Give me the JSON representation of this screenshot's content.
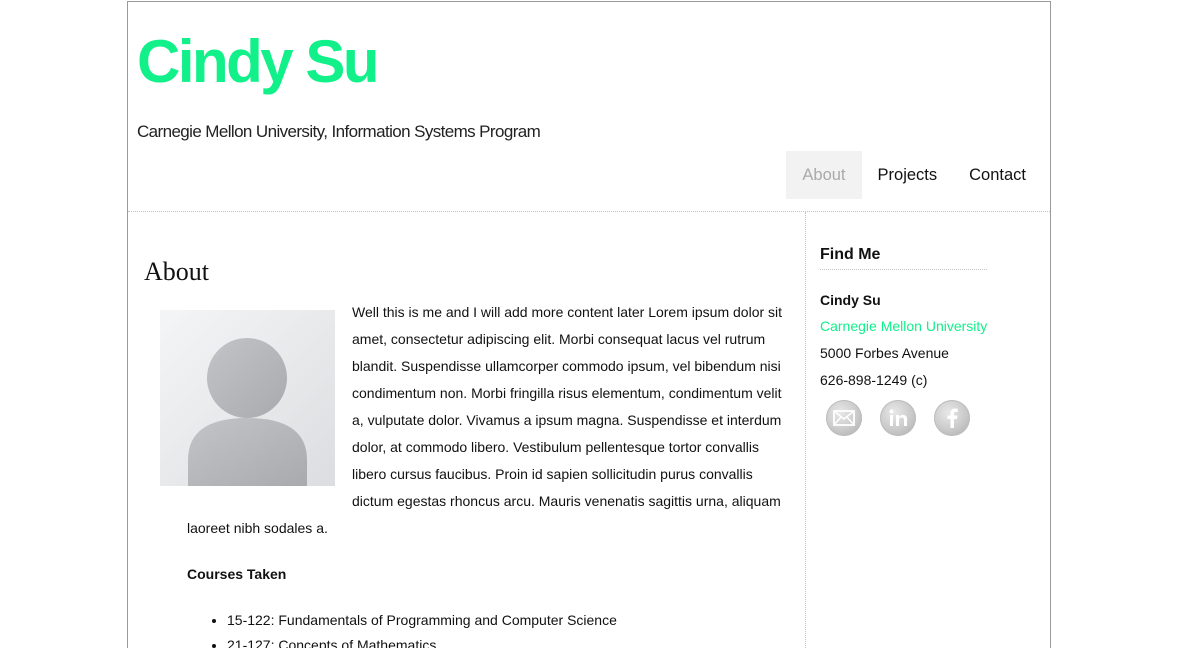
{
  "header": {
    "title": "Cindy Su",
    "tagline": "Carnegie Mellon University, Information Systems Program"
  },
  "nav": {
    "items": [
      {
        "label": "About",
        "active": true
      },
      {
        "label": "Projects",
        "active": false
      },
      {
        "label": "Contact",
        "active": false
      }
    ]
  },
  "main": {
    "title": "About",
    "intro": "Well this is me and I will add more content later Lorem ipsum dolor sit amet, consectetur adipiscing elit. Morbi consequat lacus vel rutrum blandit. Suspendisse ullamcorper commodo ipsum, vel bibendum nisi condimentum non. Morbi fringilla risus elementum, condimentum velit a, vulputate dolor. Vivamus a ipsum magna. Suspendisse et interdum dolor, at commodo libero. Vestibulum pellentesque tortor convallis libero cursus faucibus. Proin id sapien sollicitudin purus convallis dictum egestas rhoncus arcu. Mauris venenatis sagittis urna, aliquam laoreet nibh sodales a.",
    "courses_heading": "Courses Taken",
    "courses": [
      "15-122: Fundamentals of Programming and Computer Science",
      "21-127: Concepts of Mathematics"
    ]
  },
  "sidebar": {
    "heading": "Find Me",
    "name": "Cindy Su",
    "school": "Carnegie Mellon University",
    "address": "5000 Forbes Avenue",
    "phone": "626-898-1249 (c)",
    "social": [
      {
        "icon": "email-icon"
      },
      {
        "icon": "linkedin-icon"
      },
      {
        "icon": "facebook-icon"
      }
    ]
  },
  "colors": {
    "accent": "#12f08a",
    "nav_active_bg": "#f2f2f2",
    "nav_active_text": "#a9a9a9",
    "divider": "#c4c4c4"
  }
}
